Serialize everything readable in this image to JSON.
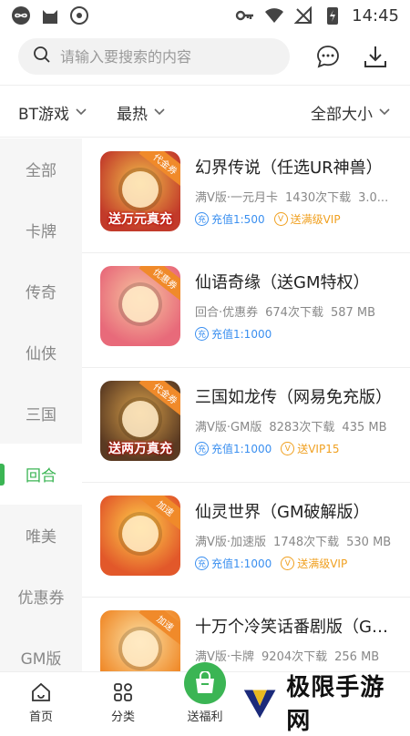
{
  "status_bar": {
    "time": "14:45"
  },
  "search": {
    "placeholder": "请输入要搜索的内容"
  },
  "filters": {
    "category": "BT游戏",
    "sort": "最热",
    "size": "全部大小"
  },
  "sidebar": {
    "items": [
      {
        "label": "全部",
        "active": false
      },
      {
        "label": "卡牌",
        "active": false
      },
      {
        "label": "传奇",
        "active": false
      },
      {
        "label": "仙侠",
        "active": false
      },
      {
        "label": "三国",
        "active": false
      },
      {
        "label": "回合",
        "active": true
      },
      {
        "label": "唯美",
        "active": false
      },
      {
        "label": "优惠券",
        "active": false
      },
      {
        "label": "GM版",
        "active": false
      }
    ]
  },
  "games": [
    {
      "title": "幻界传说（任选UR神兽）",
      "meta": [
        "满V版·一元月卡",
        "1430次下载",
        "3.0..."
      ],
      "tags": [
        {
          "type": "c",
          "text": "充值1:500"
        },
        {
          "type": "v",
          "text": "送满级VIP"
        }
      ],
      "thumb_caption": "送万元真充",
      "corner": "代金券",
      "bg": "#c23a2a",
      "bg2": "#f2c14a"
    },
    {
      "title": "仙语奇缘（送GM特权）",
      "meta": [
        "回合·优惠券",
        "674次下载",
        "587 MB"
      ],
      "tags": [
        {
          "type": "c",
          "text": "充值1:1000"
        }
      ],
      "thumb_caption": "",
      "corner": "优惠券",
      "bg": "#e86a7a",
      "bg2": "#f7c7a0"
    },
    {
      "title": "三国如龙传（网易免充版）",
      "meta": [
        "满V版·GM版",
        "8283次下载",
        "435 MB"
      ],
      "tags": [
        {
          "type": "c",
          "text": "充值1:1000"
        },
        {
          "type": "v",
          "text": "送VIP15"
        }
      ],
      "thumb_caption": "送两万真充",
      "corner": "代金券",
      "bg": "#5a3a22",
      "bg2": "#d8a04a"
    },
    {
      "title": "仙灵世界（GM破解版）",
      "meta": [
        "满V版·加速版",
        "1748次下载",
        "530 MB"
      ],
      "tags": [
        {
          "type": "c",
          "text": "充值1:1000"
        },
        {
          "type": "v",
          "text": "送满级VIP"
        }
      ],
      "thumb_caption": "",
      "corner": "加速",
      "bg": "#e2582a",
      "bg2": "#ffd24a"
    },
    {
      "title": "十万个冷笑话番剧版（GM...",
      "meta": [
        "满V版·卡牌",
        "9204次下载",
        "256 MB"
      ],
      "tags": [],
      "thumb_caption": "",
      "corner": "加速",
      "bg": "#f08a2a",
      "bg2": "#fbe3a8"
    }
  ],
  "tabbar": {
    "home": "首页",
    "category": "分类",
    "welfare": "送福利"
  },
  "watermark": {
    "text": "极限手游网"
  },
  "colors": {
    "accent": "#3bb554",
    "charge": "#3a8ff0",
    "vip": "#f0a020"
  }
}
